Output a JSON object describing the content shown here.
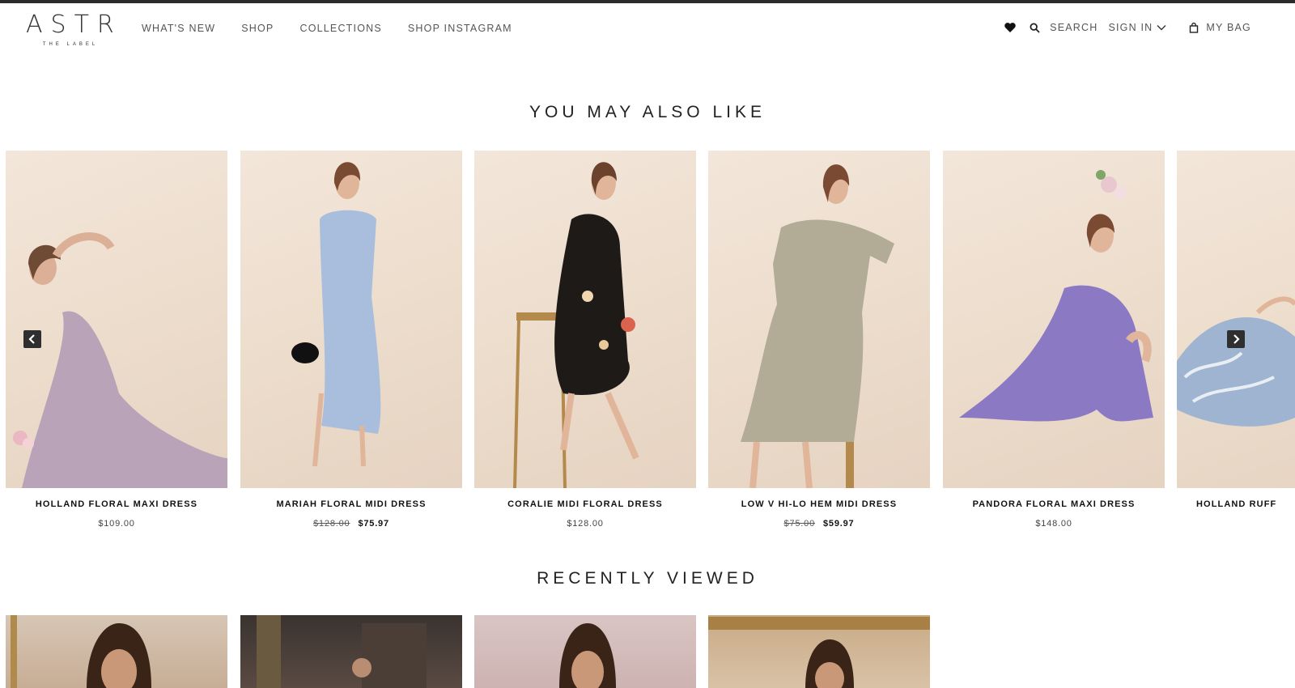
{
  "brand": {
    "logo_main": "ASTR",
    "logo_sub": "THE LABEL"
  },
  "nav": {
    "items": [
      "WHAT'S NEW",
      "SHOP",
      "COLLECTIONS",
      "SHOP INSTAGRAM"
    ]
  },
  "utility": {
    "search_label": "SEARCH",
    "signin_label": "SIGN IN",
    "bag_label": "MY BAG"
  },
  "sections": {
    "also_like_title": "YOU MAY ALSO LIKE",
    "recently_viewed_title": "RECENTLY VIEWED"
  },
  "products": [
    {
      "name": "HOLLAND FLORAL MAXI DRESS",
      "price": "$109.00",
      "dress_color": "#b9a3b8"
    },
    {
      "name": "MARIAH FLORAL MIDI DRESS",
      "old_price": "$128.00",
      "sale_price": "$75.97",
      "dress_color": "#a9bedc"
    },
    {
      "name": "CORALIE MIDI FLORAL DRESS",
      "price": "$128.00",
      "dress_color": "#1e1a18"
    },
    {
      "name": "LOW V HI-LO HEM MIDI DRESS",
      "old_price": "$75.00",
      "sale_price": "$59.97",
      "dress_color": "#b2ab96"
    },
    {
      "name": "PANDORA FLORAL MAXI DRESS",
      "price": "$148.00",
      "dress_color": "#8c79c4"
    },
    {
      "name": "HOLLAND RUFF",
      "dress_color": "#9fb4d0"
    }
  ],
  "icons": {
    "heart": "heart-icon",
    "search": "search-icon",
    "chevron": "chevron-down-icon",
    "bag": "bag-icon",
    "prev": "chevron-left-icon",
    "next": "chevron-right-icon"
  }
}
